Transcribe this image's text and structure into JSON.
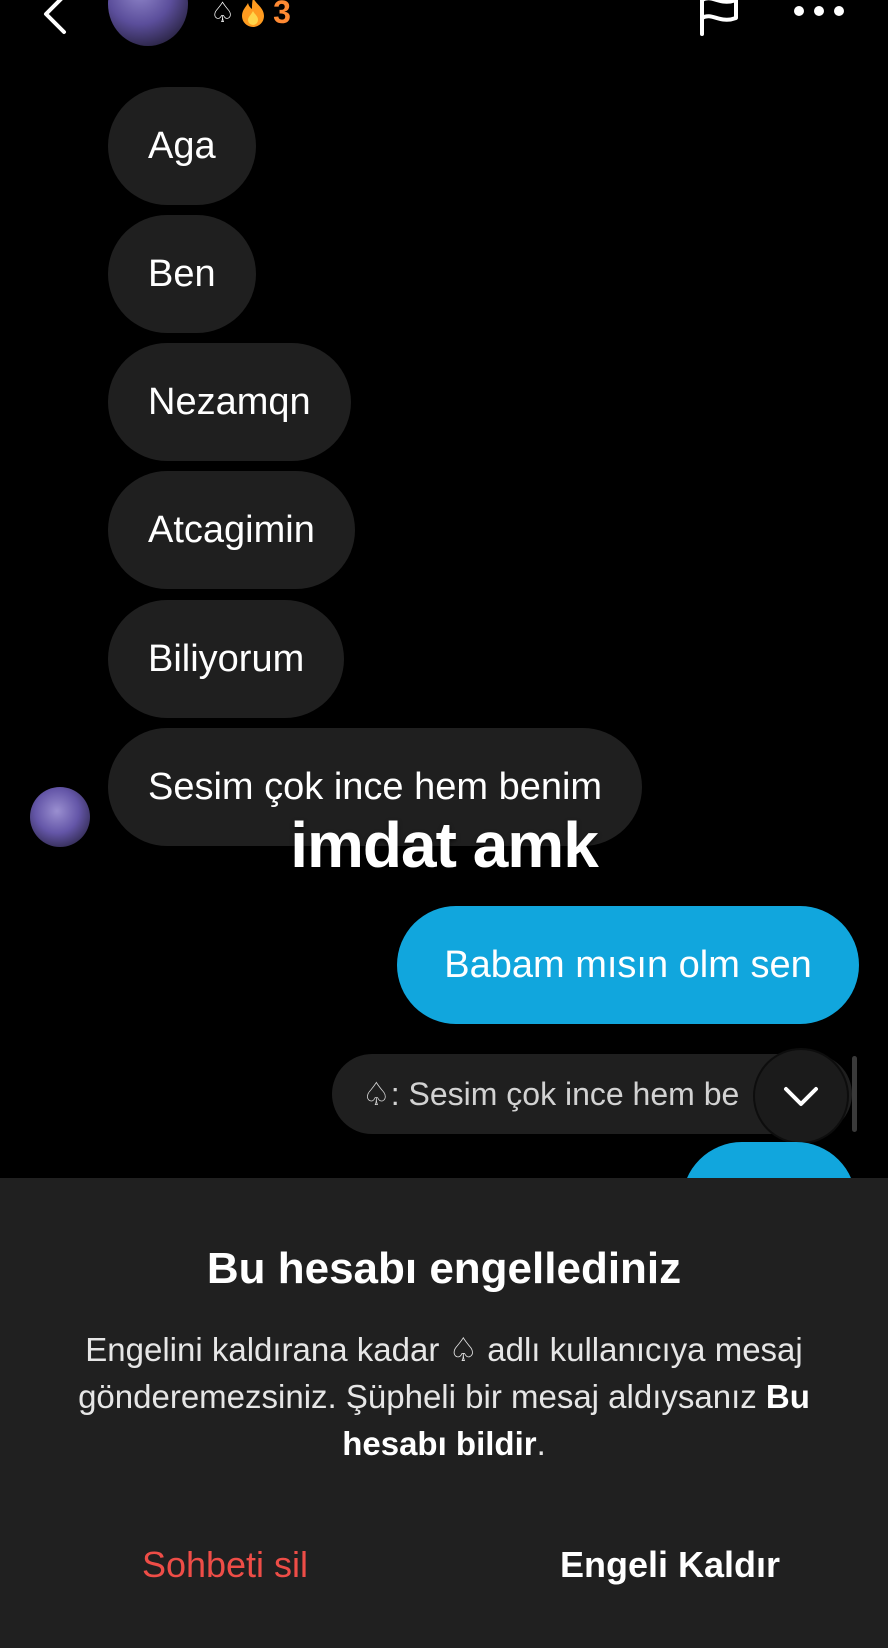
{
  "header": {
    "spade_symbol": "♤",
    "streak_count": "3",
    "streak_color": "#ff8a33"
  },
  "messages_received": [
    {
      "text": "Aga"
    },
    {
      "text": "Ben"
    },
    {
      "text": "Nezamqn"
    },
    {
      "text": "Atcagimin"
    },
    {
      "text": "Biliyorum"
    },
    {
      "text": "Sesim çok ince hem benim"
    }
  ],
  "overlay_caption": "imdat amk",
  "message_sent": {
    "text": "Babam mısın olm sen"
  },
  "reply_preview": {
    "text": "♤: Sesim çok ince hem be"
  },
  "blocked_sheet": {
    "title": "Bu hesabı engellediniz",
    "body_part1": "Engelini kaldırana kadar ♤ adlı kullanıcıya mesaj gönderemezsiniz. Şüpheli bir mesaj aldıysanız ",
    "body_link": "Bu hesabı bildir",
    "body_part2": ".",
    "delete_label": "Sohbeti sil",
    "unblock_label": "Engeli Kaldır"
  },
  "colors": {
    "background": "#000000",
    "bubble_in": "#1f1f1f",
    "bubble_out": "#11a6dd",
    "sheet": "#202020",
    "delete": "#ee4d47"
  },
  "icons": [
    "back-icon",
    "fire-icon",
    "flag-icon",
    "more-icon",
    "chevron-down-icon"
  ]
}
